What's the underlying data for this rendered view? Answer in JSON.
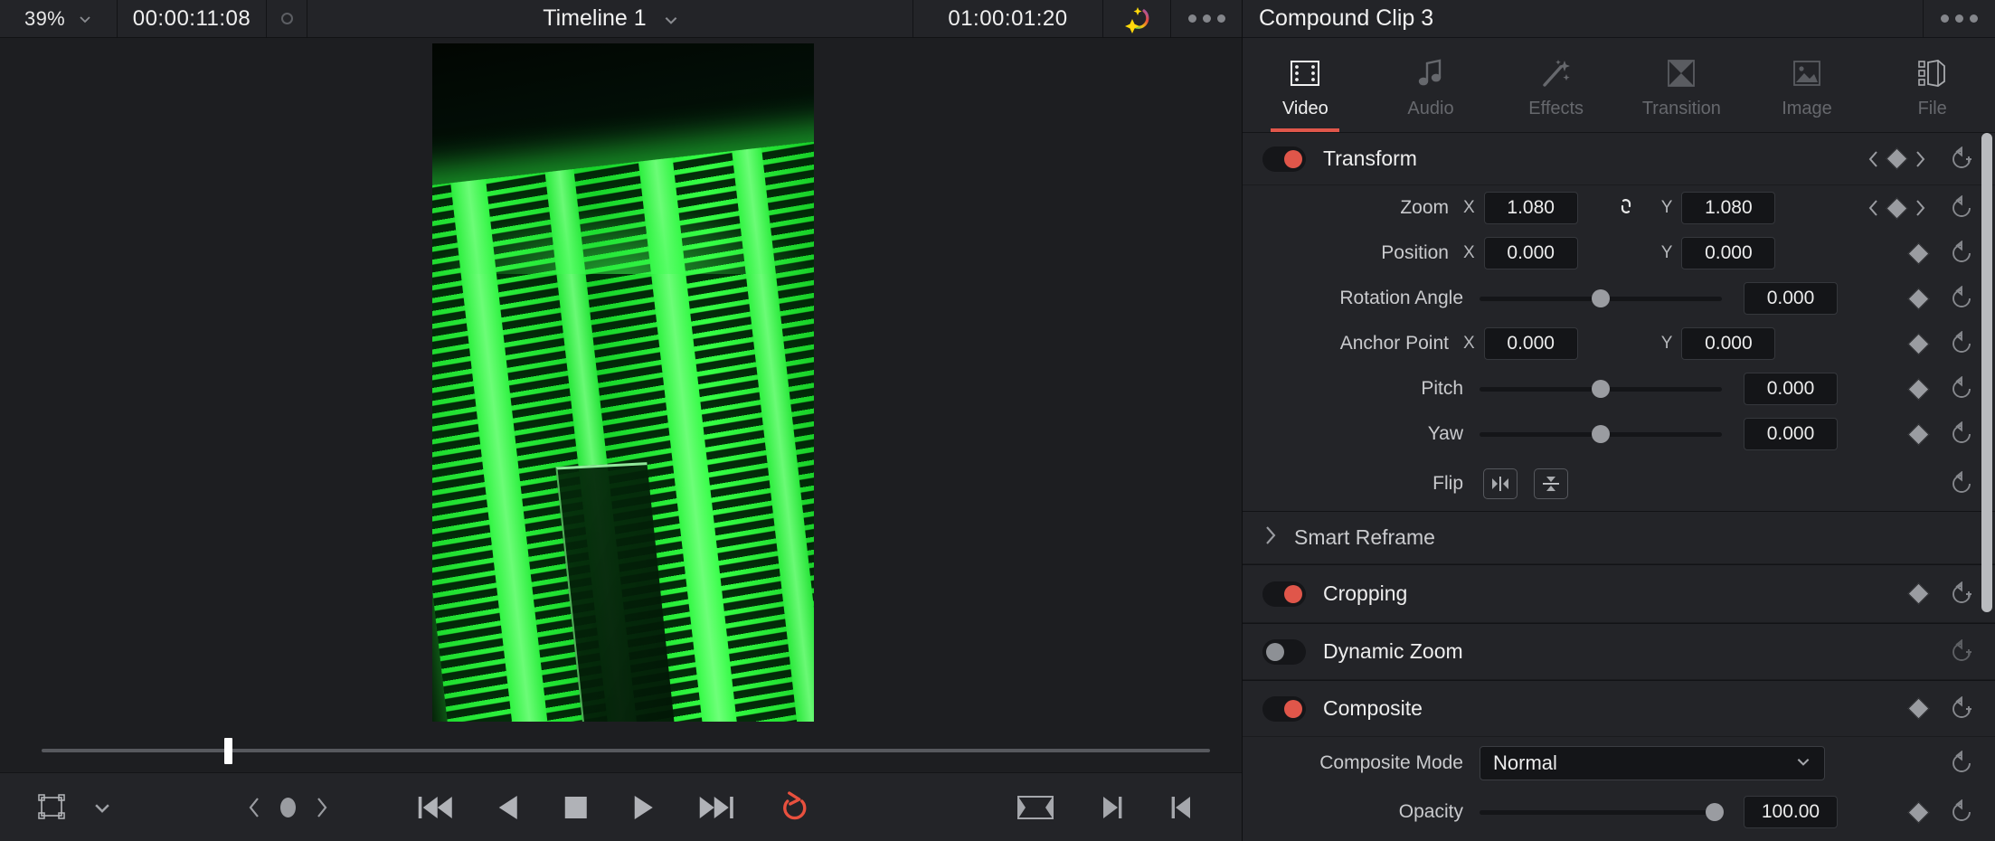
{
  "viewer": {
    "zoom_level": "39%",
    "timecode_current": "00:00:11:08",
    "timeline_title": "Timeline 1",
    "timecode_duration": "01:00:01:20",
    "icons": {
      "zoom_dropdown": "chevron-down-icon",
      "record_dot": "record-indicator-icon",
      "title_dropdown": "chevron-down-icon",
      "ai_magic": "ai-magic-icon",
      "overflow": "more-options-icon"
    },
    "transport": {
      "transform_tool": "transform-tool-icon",
      "tool_dropdown": "chevron-down-icon",
      "keyframe_prev": "prev-keyframe-icon",
      "keyframe_marker": "keyframe-oval-icon",
      "keyframe_next": "next-keyframe-icon",
      "jump_start": "jump-to-start-icon",
      "reverse": "play-reverse-icon",
      "stop": "stop-icon",
      "play": "play-icon",
      "fast_forward": "fast-forward-icon",
      "loop": "loop-icon",
      "loop_active_color": "#e0564a",
      "in_out_range": "mark-in-out-icon",
      "goto_out": "go-to-out-point-icon",
      "goto_in": "go-to-in-point-icon"
    },
    "playhead_percent": 11.3
  },
  "inspector": {
    "title": "Compound Clip 3",
    "overflow_icon": "more-options-icon",
    "accent_color": "#e0564a",
    "tabs": [
      {
        "label": "Video",
        "icon": "video-clip-icon",
        "active": true
      },
      {
        "label": "Audio",
        "icon": "music-note-icon",
        "active": false
      },
      {
        "label": "Effects",
        "icon": "magic-wand-icon",
        "active": false
      },
      {
        "label": "Transition",
        "icon": "transition-icon",
        "active": false
      },
      {
        "label": "Image",
        "icon": "image-icon",
        "active": false
      },
      {
        "label": "File",
        "icon": "file-stack-icon",
        "active": false
      }
    ],
    "sections": {
      "transform": {
        "title": "Transform",
        "enabled": true,
        "keyframe_prev_icon": "prev-keyframe-icon",
        "keyframe_icon": "keyframe-diamond-icon",
        "keyframe_next_icon": "next-keyframe-icon",
        "reset_icon": "reset-add-icon",
        "rows": [
          {
            "label": "Zoom",
            "type": "xy",
            "x_axis": "X",
            "x_value": "1.080",
            "link_icon": "link-icon",
            "y_axis": "Y",
            "y_value": "1.080",
            "has_keyframe_nav": true,
            "reset_icon": "reset-icon"
          },
          {
            "label": "Position",
            "type": "xy",
            "x_axis": "X",
            "x_value": "0.000",
            "y_axis": "Y",
            "y_value": "0.000",
            "has_keyframe_nav": false,
            "reset_icon": "reset-icon"
          },
          {
            "label": "Rotation Angle",
            "type": "slider",
            "value": "0.000",
            "slider_percent": 50,
            "reset_icon": "reset-icon"
          },
          {
            "label": "Anchor Point",
            "type": "xy",
            "x_axis": "X",
            "x_value": "0.000",
            "y_axis": "Y",
            "y_value": "0.000",
            "has_keyframe_nav": false,
            "reset_icon": "reset-icon"
          },
          {
            "label": "Pitch",
            "type": "slider",
            "value": "0.000",
            "slider_percent": 50,
            "reset_icon": "reset-icon"
          },
          {
            "label": "Yaw",
            "type": "slider",
            "value": "0.000",
            "slider_percent": 50,
            "reset_icon": "reset-icon"
          },
          {
            "label": "Flip",
            "type": "flip",
            "horizontal_icon": "flip-horizontal-icon",
            "vertical_icon": "flip-vertical-icon",
            "reset_icon": "reset-icon"
          }
        ]
      },
      "smart_reframe": {
        "title": "Smart Reframe",
        "collapsed": true,
        "expand_icon": "chevron-right-icon"
      },
      "cropping": {
        "title": "Cropping",
        "enabled": true,
        "keyframe_icon": "keyframe-diamond-icon",
        "reset_icon": "reset-add-icon"
      },
      "dynamic_zoom": {
        "title": "Dynamic Zoom",
        "enabled": false,
        "reset_icon": "reset-add-icon"
      },
      "composite": {
        "title": "Composite",
        "enabled": true,
        "keyframe_icon": "keyframe-diamond-icon",
        "reset_icon": "reset-add-icon",
        "mode_label": "Composite Mode",
        "mode_value": "Normal",
        "mode_dropdown_icon": "chevron-down-icon",
        "mode_reset_icon": "reset-icon",
        "opacity_label": "Opacity",
        "opacity_value": "100.00",
        "opacity_percent": 100,
        "opacity_keyframe_icon": "keyframe-diamond-icon",
        "opacity_reset_icon": "reset-icon"
      }
    }
  }
}
